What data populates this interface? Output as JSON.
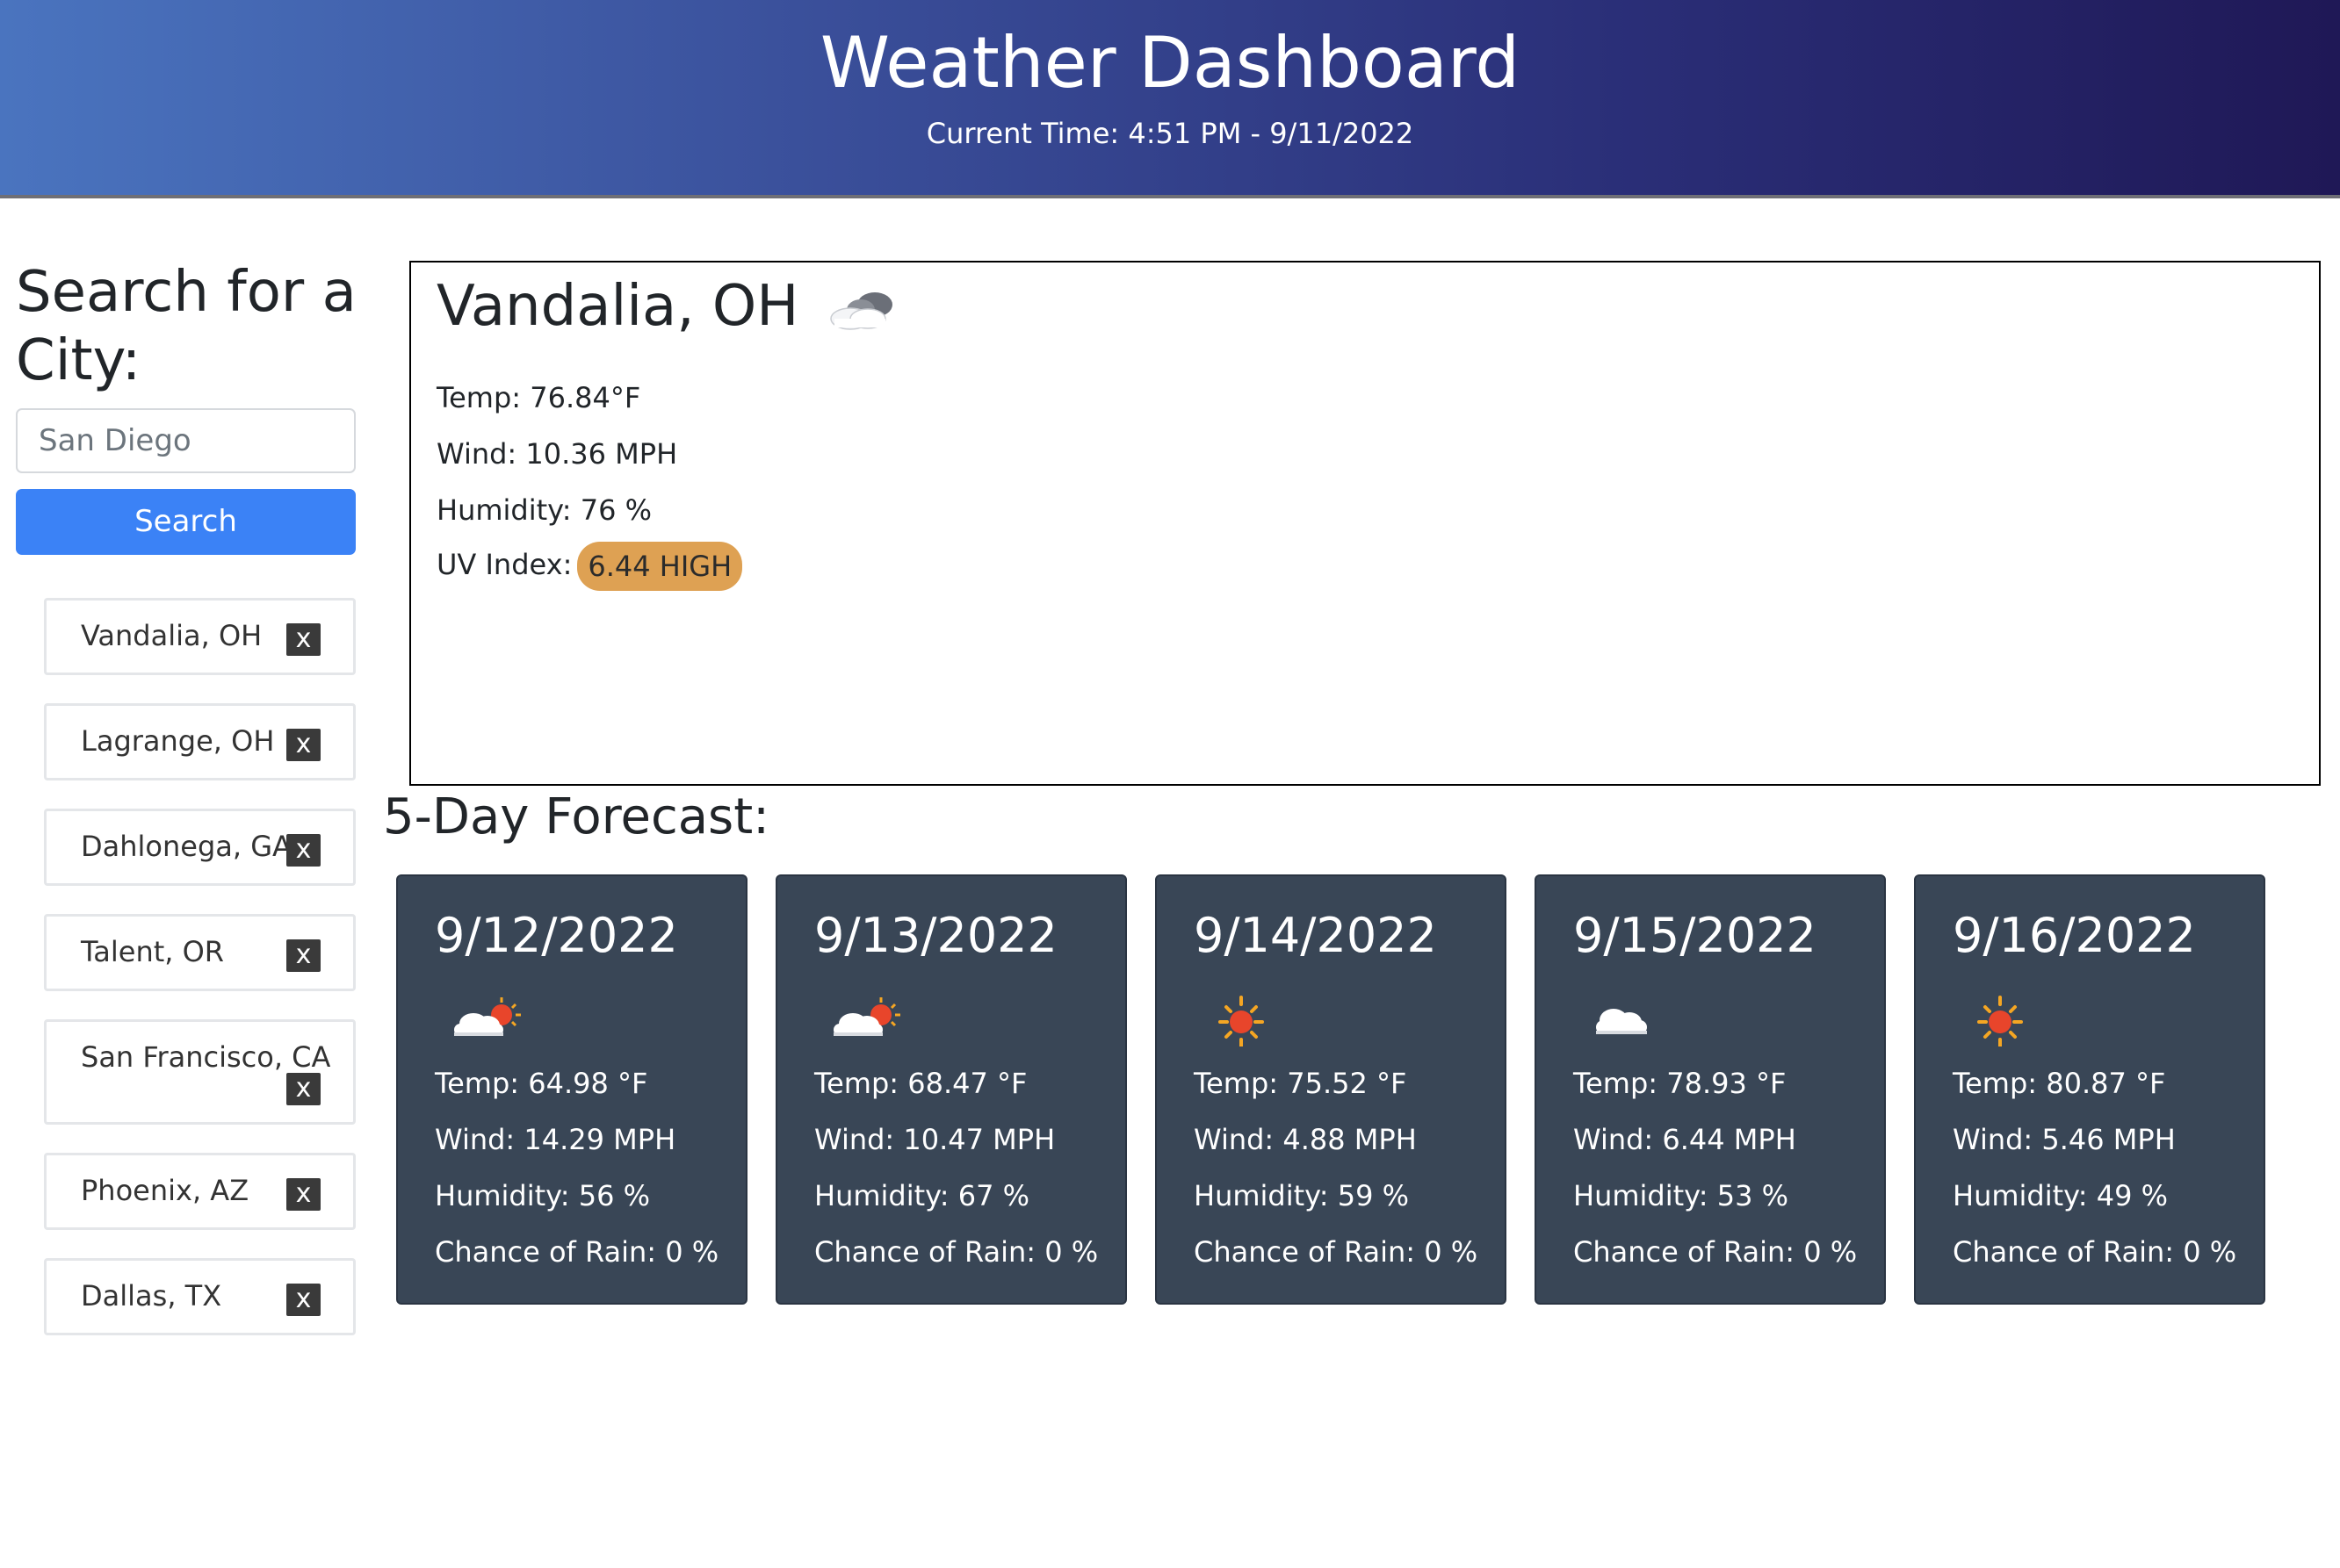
{
  "header": {
    "title": "Weather Dashboard",
    "current_time": "Current Time: 4:51 PM - 9/11/2022"
  },
  "sidebar": {
    "heading": "Search for a City:",
    "search_placeholder": "San Diego",
    "search_button": "Search",
    "history": [
      {
        "label": "Vandalia, OH",
        "remove": "x"
      },
      {
        "label": "Lagrange, OH",
        "remove": "x"
      },
      {
        "label": "Dahlonega, GA",
        "remove": "x"
      },
      {
        "label": "Talent, OR",
        "remove": "x"
      },
      {
        "label": "San Francisco, CA",
        "remove": "x"
      },
      {
        "label": "Phoenix, AZ",
        "remove": "x"
      },
      {
        "label": "Dallas, TX",
        "remove": "x"
      }
    ]
  },
  "current": {
    "city": "Vandalia, OH",
    "icon": "cloudy-icon",
    "temp": "Temp: 76.84°F",
    "wind": "Wind: 10.36 MPH",
    "humidity": "Humidity: 76 %",
    "uv_label": "UV Index:",
    "uv_value": "6.44 HIGH",
    "uv_color": "#dea153"
  },
  "forecast": {
    "heading": "5-Day Forecast:",
    "days": [
      {
        "date": "9/12/2022",
        "icon": "partly-cloudy-icon",
        "temp": "Temp: 64.98 °F",
        "wind": "Wind: 14.29 MPH",
        "humidity": "Humidity: 56 %",
        "rain": "Chance of Rain: 0 %"
      },
      {
        "date": "9/13/2022",
        "icon": "partly-cloudy-icon",
        "temp": "Temp: 68.47 °F",
        "wind": "Wind: 10.47 MPH",
        "humidity": "Humidity: 67 %",
        "rain": "Chance of Rain: 0 %"
      },
      {
        "date": "9/14/2022",
        "icon": "sun-icon",
        "temp": "Temp: 75.52 °F",
        "wind": "Wind: 4.88 MPH",
        "humidity": "Humidity: 59 %",
        "rain": "Chance of Rain: 0 %"
      },
      {
        "date": "9/15/2022",
        "icon": "cloud-icon",
        "temp": "Temp: 78.93 °F",
        "wind": "Wind: 6.44 MPH",
        "humidity": "Humidity: 53 %",
        "rain": "Chance of Rain: 0 %"
      },
      {
        "date": "9/16/2022",
        "icon": "sun-icon",
        "temp": "Temp: 80.87 °F",
        "wind": "Wind: 5.46 MPH",
        "humidity": "Humidity: 49 %",
        "rain": "Chance of Rain: 0 %"
      }
    ]
  },
  "colors": {
    "header_gradient_start": "#4a74bf",
    "header_gradient_end": "#1f1856",
    "search_button": "#3b82f6",
    "forecast_card": "#394656"
  }
}
